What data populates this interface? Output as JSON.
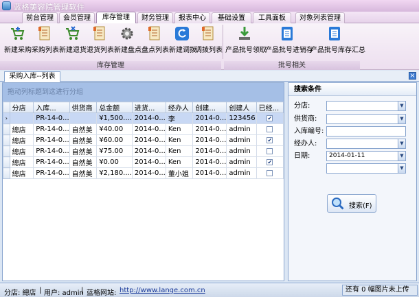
{
  "window": {
    "title": "蓝格美容院管理软件"
  },
  "menu_tabs": [
    "前台管理",
    "会员管理",
    "库存管理",
    "财务管理",
    "报表中心",
    "基础设置",
    "工具面板",
    "对象列表管理"
  ],
  "active_menu": "库存管理",
  "ribbon": {
    "group1_label": "库存管理",
    "group2_label": "批号相关",
    "buttons": [
      "新建采购",
      "采购列表",
      "新建退货",
      "退货列表",
      "新建盘点",
      "盘点列表",
      "新建调拨",
      "调拨列表"
    ],
    "batch_buttons": [
      "产品批号领取",
      "产品批号进销存",
      "产品批号库存汇总"
    ]
  },
  "doc_tab": {
    "label": "采购入库--列表",
    "close": "×"
  },
  "grid": {
    "group_hint": "拖动列标题到这进行分组",
    "columns": [
      "分店",
      "入库...",
      "供货商",
      "总金额",
      "进货...",
      "经办人",
      "创建...",
      "创建人",
      "已经..."
    ],
    "rows": [
      [
        "",
        "PR-14-0...",
        "",
        "¥1,500....",
        "2014-0...",
        "李",
        "2014-0...",
        "123456",
        "✔"
      ],
      [
        "總店",
        "PR-14-0...",
        "自然美",
        "¥40.00",
        "2014-0...",
        "Ken",
        "2014-0...",
        "admin",
        ""
      ],
      [
        "總店",
        "PR-14-0...",
        "自然美",
        "¥60.00",
        "2014-0...",
        "Ken",
        "2014-0...",
        "admin",
        "✔"
      ],
      [
        "總店",
        "PR-14-0...",
        "自然美",
        "¥75.00",
        "2014-0...",
        "Ken",
        "2014-0...",
        "admin",
        ""
      ],
      [
        "總店",
        "PR-14-0...",
        "自然美",
        "¥0.00",
        "2014-0...",
        "Ken",
        "2014-0...",
        "admin",
        "✔"
      ],
      [
        "總店",
        "PR-14-0...",
        "自然美",
        "¥2,180....",
        "2014-0...",
        "董小姐",
        "2014-0...",
        "admin",
        ""
      ]
    ],
    "current_row_marker": "›"
  },
  "search": {
    "title": "搜索条件",
    "labels": [
      "分店:",
      "供货商:",
      "入库编号:",
      "经办人:",
      "日期:"
    ],
    "date_value": "2014-01-11",
    "button_label": "搜索(F)"
  },
  "status": {
    "branch": "分店: 總店",
    "user": "用户: admin",
    "site_label": "蓝格网站:",
    "site_url": "http://www.lange.com.cn",
    "right_text": "还有 0 幅图片未上传"
  }
}
